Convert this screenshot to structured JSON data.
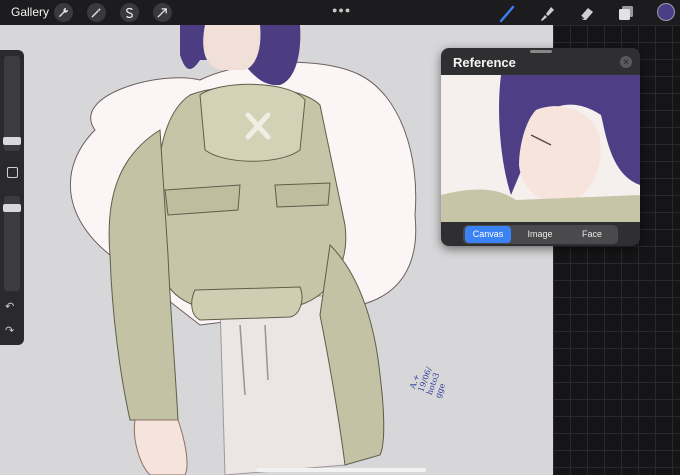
{
  "topbar": {
    "gallery_label": "Gallery",
    "left_tools": [
      "wrench-icon",
      "magic-wand-icon",
      "selection-s-icon",
      "transform-arrow-icon"
    ],
    "right_tools": [
      "brush-icon",
      "smudge-icon",
      "eraser-icon",
      "layers-icon"
    ],
    "active_color": "#4a3f86",
    "brush_color": "#3b82f6"
  },
  "reference": {
    "title": "Reference",
    "tabs": [
      "Canvas",
      "Image",
      "Face"
    ],
    "active_tab": "Canvas"
  },
  "canvas": {
    "signature": [
      "A.+",
      "19/06/",
      "hoto3",
      "gge"
    ]
  }
}
